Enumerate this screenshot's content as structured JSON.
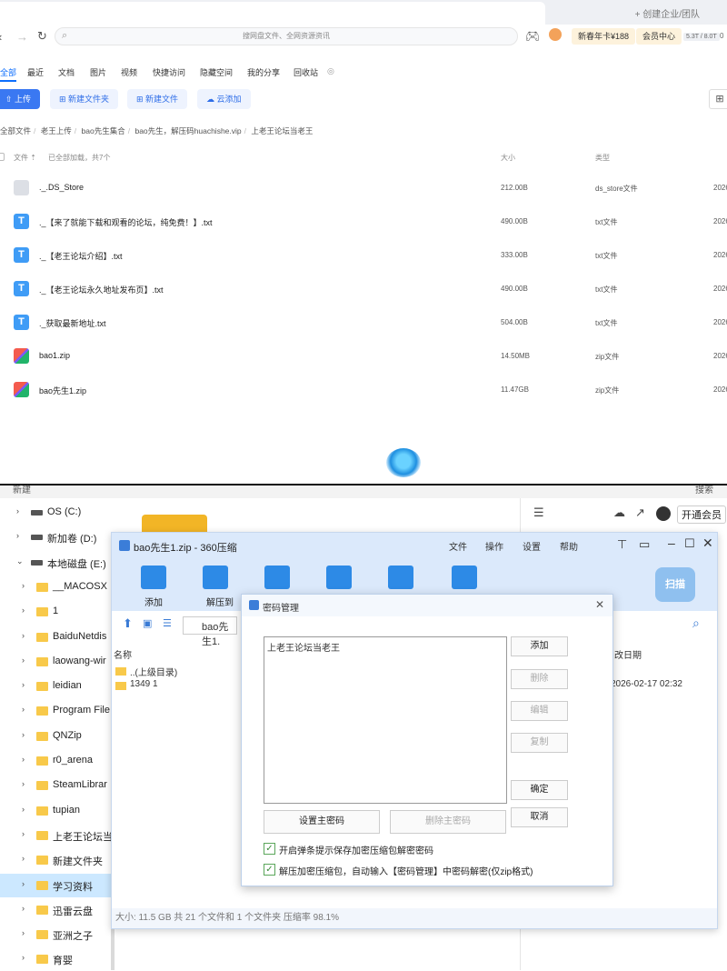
{
  "browser": {
    "tabbar_right": "+ 创建企业/团队",
    "search_placeholder": "搜网盘文件、全网资源资讯",
    "promo_label": "新春年卡¥188",
    "vip_label": "会员中心",
    "quota": "5.3T / 8.0T",
    "quota_suffix": "0"
  },
  "categories": [
    {
      "label": "全部",
      "active": true
    },
    {
      "label": "最近"
    },
    {
      "label": "文档"
    },
    {
      "label": "图片"
    },
    {
      "label": "视频"
    },
    {
      "label": "快捷访问"
    },
    {
      "label": "隐藏空间"
    },
    {
      "label": "我的分享"
    },
    {
      "label": "回收站"
    }
  ],
  "toolbar": {
    "upload": "上传",
    "new_folder": "新建文件夹",
    "new_file": "新建文件",
    "cloud_add": "云添加"
  },
  "breadcrumb": [
    "全部文件",
    "老王上传",
    "bao先生集合",
    "bao先生，解压码huachishe.vip",
    "上老王论坛当老王"
  ],
  "list_header": {
    "name": "文件",
    "loaded": "已全部加载，共7个",
    "size": "大小",
    "type": "类型"
  },
  "files": [
    {
      "name": "._.DS_Store",
      "size": "212.00B",
      "type": "ds_store文件",
      "date": "2026",
      "icon": "cloud"
    },
    {
      "name": "._【来了就能下载和观看的论坛，纯免费！】.txt",
      "size": "490.00B",
      "type": "txt文件",
      "date": "2026",
      "icon": "txt"
    },
    {
      "name": "._【老王论坛介绍】.txt",
      "size": "333.00B",
      "type": "txt文件",
      "date": "2026",
      "icon": "txt"
    },
    {
      "name": "._【老王论坛永久地址发布页】.txt",
      "size": "490.00B",
      "type": "txt文件",
      "date": "2026",
      "icon": "txt"
    },
    {
      "name": "._获取最新地址.txt",
      "size": "504.00B",
      "type": "txt文件",
      "date": "2026",
      "icon": "txt"
    },
    {
      "name": "bao1.zip",
      "size": "14.50MB",
      "type": "zip文件",
      "date": "2026",
      "icon": "zip"
    },
    {
      "name": "bao先生1.zip",
      "size": "11.47GB",
      "type": "zip文件",
      "date": "2026",
      "icon": "zip"
    }
  ],
  "explorer": {
    "strip_left": "新建",
    "strip_right": "搜索",
    "vip_button": "开通会员",
    "tree": [
      {
        "label": "OS (C:)",
        "kind": "drive",
        "indent": 1
      },
      {
        "label": "新加卷 (D:)",
        "kind": "drive",
        "indent": 1
      },
      {
        "label": "本地磁盘 (E:)",
        "kind": "drive",
        "indent": 1,
        "expanded": true
      },
      {
        "label": "__MACOSX",
        "kind": "folder",
        "indent": 2
      },
      {
        "label": "1",
        "kind": "folder",
        "indent": 2
      },
      {
        "label": "BaiduNetdis",
        "kind": "folder",
        "indent": 2
      },
      {
        "label": "laowang-wir",
        "kind": "folder",
        "indent": 2
      },
      {
        "label": "leidian",
        "kind": "folder",
        "indent": 2
      },
      {
        "label": "Program File",
        "kind": "folder",
        "indent": 2
      },
      {
        "label": "QNZip",
        "kind": "folder",
        "indent": 2
      },
      {
        "label": "r0_arena",
        "kind": "folder",
        "indent": 2
      },
      {
        "label": "SteamLibrar",
        "kind": "folder",
        "indent": 2
      },
      {
        "label": "tupian",
        "kind": "folder",
        "indent": 2
      },
      {
        "label": "上老王论坛当",
        "kind": "folder",
        "indent": 2
      },
      {
        "label": "新建文件夹",
        "kind": "folder",
        "indent": 2
      },
      {
        "label": "学习资料",
        "kind": "folder",
        "indent": 2,
        "selected": true
      },
      {
        "label": "迅雷云盘",
        "kind": "folder",
        "indent": 2
      },
      {
        "label": "亚洲之子",
        "kind": "folder",
        "indent": 2
      },
      {
        "label": "育婴",
        "kind": "folder",
        "indent": 2
      }
    ]
  },
  "zip": {
    "title": "bao先生1.zip - 360压缩",
    "menu": [
      "文件",
      "操作",
      "设置",
      "帮助"
    ],
    "tools": [
      {
        "label": "添加"
      },
      {
        "label": "解压到"
      },
      {
        "label": ""
      },
      {
        "label": ""
      },
      {
        "label": ""
      },
      {
        "label": ""
      }
    ],
    "scan": "扫描",
    "path": "bao先生1.",
    "col_name": "名称",
    "col_date": "改日期",
    "rows": [
      {
        "name": "..(上级目录)",
        "date": ""
      },
      {
        "name": "1349 1",
        "date": "2026-02-17 02:32"
      }
    ],
    "status": "大小: 11.5 GB 共 21 个文件和 1 个文件夹 压缩率 98.1%"
  },
  "dialog": {
    "title": "密码管理",
    "entry": "上老王论坛当老王",
    "buttons": {
      "add": "添加",
      "delete": "删除",
      "edit": "编辑",
      "copy": "复制",
      "ok": "确定",
      "cancel": "取消"
    },
    "set_master": "设置主密码",
    "delete_master": "删除主密码",
    "option1": "开启弹条提示保存加密压缩包解密密码",
    "option2": "解压加密压缩包，自动输入【密码管理】中密码解密(仅zip格式)"
  }
}
